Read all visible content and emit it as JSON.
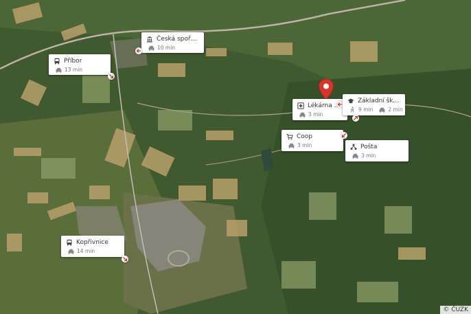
{
  "map": {
    "copyright": "© ČUZK",
    "colors": {
      "arrow": "#c0392b",
      "pin": "#d9342b",
      "card_bg": "#ffffff",
      "title_text": "#333333",
      "sub_text": "#777777"
    }
  },
  "places": [
    {
      "name": "Česká spořitelna",
      "icon": "bank-icon",
      "transport_icon": "car-icon",
      "time": "10 min"
    },
    {
      "name": "Příbor",
      "icon": "bus-icon",
      "transport_icon": "car-icon",
      "time": "13 min"
    },
    {
      "name": "Lékárna Rych...",
      "icon": "pharmacy-icon",
      "transport_icon": "car-icon",
      "time": "3 min"
    },
    {
      "name": "Základní škola a ...",
      "icon": "school-icon",
      "transport_icon": "walk-icon",
      "time": "9 min",
      "transport_icon_2": "car-icon",
      "time_2": "2 min"
    },
    {
      "name": "Coop",
      "icon": "cart-icon",
      "transport_icon": "car-icon",
      "time": "3 min"
    },
    {
      "name": "Pošta",
      "icon": "post-icon",
      "transport_icon": "car-icon",
      "time": "3 min"
    },
    {
      "name": "Kopřivnice",
      "icon": "bus-icon",
      "transport_icon": "car-icon",
      "time": "14 min"
    }
  ]
}
